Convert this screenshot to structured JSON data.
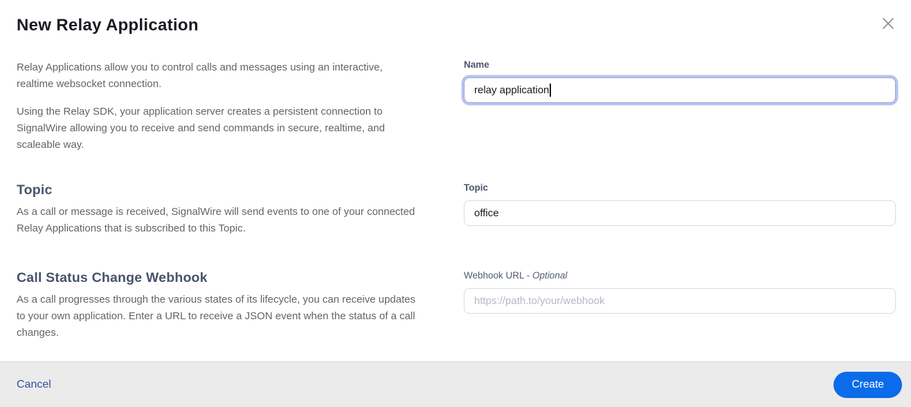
{
  "dialog": {
    "title": "New Relay Application"
  },
  "intro": {
    "paragraph1": "Relay Applications allow you to control calls and messages using an interactive, realtime websocket connection.",
    "paragraph2": "Using the Relay SDK, your application server creates a persistent connection to SignalWire allowing you to receive and send commands in secure, realtime, and scaleable way."
  },
  "sections": {
    "topic": {
      "heading": "Topic",
      "description": "As a call or message is received, SignalWire will send events to one of your connected Relay Applications that is subscribed to this Topic."
    },
    "webhook": {
      "heading": "Call Status Change Webhook",
      "description": "As a call progresses through the various states of its lifecycle, you can receive updates to your own application. Enter a URL to receive a JSON event when the status of a call changes."
    }
  },
  "form": {
    "name": {
      "label": "Name",
      "value": "relay application"
    },
    "topic": {
      "label": "Topic",
      "value": "office"
    },
    "webhook": {
      "label_prefix": "Webhook URL - ",
      "label_optional": "Optional",
      "placeholder": "https://path.to/your/webhook"
    }
  },
  "footer": {
    "cancel_label": "Cancel",
    "create_label": "Create"
  },
  "icons": {
    "close": "close-icon"
  },
  "colors": {
    "accent_blue": "#0b6be9",
    "link_blue": "#3a4d9e",
    "focus_ring": "#b9c5f0",
    "footer_bg": "#ebebeb"
  }
}
